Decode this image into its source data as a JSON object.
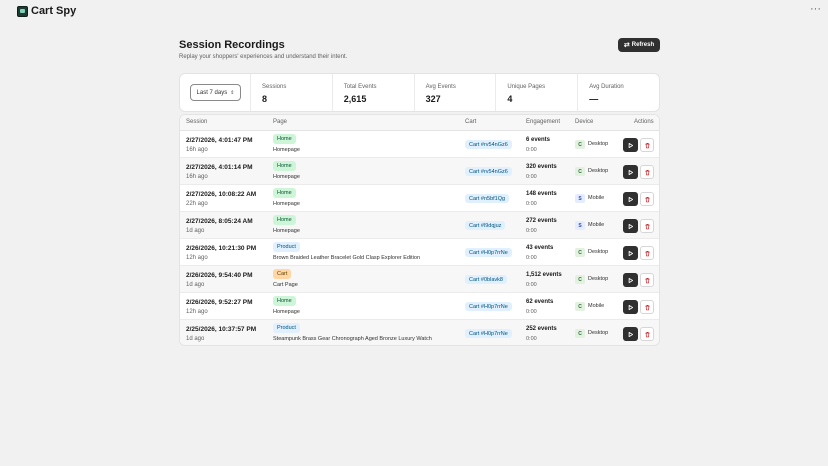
{
  "app": {
    "title": "Cart Spy",
    "more_label": "···"
  },
  "header": {
    "title": "Session Recordings",
    "subtitle": "Replay your shoppers' experiences and understand their intent.",
    "refresh_label": "Refresh"
  },
  "filter": {
    "range_label": "Last 7 days"
  },
  "stats": [
    {
      "label": "Sessions",
      "value": "8"
    },
    {
      "label": "Total Events",
      "value": "2,615"
    },
    {
      "label": "Avg Events",
      "value": "327"
    },
    {
      "label": "Unique Pages",
      "value": "4"
    },
    {
      "label": "Avg Duration",
      "value": "—"
    }
  ],
  "table": {
    "columns": {
      "session": "Session",
      "page": "Page",
      "cart": "Cart",
      "engagement": "Engagement",
      "device": "Device",
      "actions": "Actions"
    },
    "rows": [
      {
        "date": "2/27/2026, 4:01:47 PM",
        "ago": "16h ago",
        "page_type": "Home",
        "page_kind": "home",
        "page_name": "Homepage",
        "cart": "Cart #rv54nGz6",
        "events": "6 events",
        "duration": "0:00",
        "device": "Desktop",
        "device_initial": "C",
        "device_kind": "desktop"
      },
      {
        "date": "2/27/2026, 4:01:14 PM",
        "ago": "16h ago",
        "page_type": "Home",
        "page_kind": "home",
        "page_name": "Homepage",
        "cart": "Cart #rv54nGz6",
        "events": "320 events",
        "duration": "0:00",
        "device": "Desktop",
        "device_initial": "C",
        "device_kind": "desktop"
      },
      {
        "date": "2/27/2026, 10:08:22 AM",
        "ago": "22h ago",
        "page_type": "Home",
        "page_kind": "home",
        "page_name": "Homepage",
        "cart": "Cart #n5bf1Qg",
        "events": "148 events",
        "duration": "0:00",
        "device": "Mobile",
        "device_initial": "S",
        "device_kind": "mobile"
      },
      {
        "date": "2/27/2026, 8:05:24 AM",
        "ago": "1d ago",
        "page_type": "Home",
        "page_kind": "home",
        "page_name": "Homepage",
        "cart": "Cart #l9dqjuz",
        "events": "272 events",
        "duration": "0:00",
        "device": "Mobile",
        "device_initial": "S",
        "device_kind": "mobile"
      },
      {
        "date": "2/26/2026, 10:21:30 PM",
        "ago": "12h ago",
        "page_type": "Product",
        "page_kind": "product",
        "page_name": "Brown Braided Leather Bracelet Gold Clasp Explorer Edition",
        "cart": "Cart #H0p7rrNe",
        "events": "43 events",
        "duration": "0:00",
        "device": "Desktop",
        "device_initial": "C",
        "device_kind": "desktop"
      },
      {
        "date": "2/26/2026, 9:54:40 PM",
        "ago": "1d ago",
        "page_type": "Cart",
        "page_kind": "cart",
        "page_name": "Cart Page",
        "cart": "Cart #0blavk8",
        "events": "1,512 events",
        "duration": "0:00",
        "device": "Desktop",
        "device_initial": "C",
        "device_kind": "desktop"
      },
      {
        "date": "2/26/2026, 9:52:27 PM",
        "ago": "12h ago",
        "page_type": "Home",
        "page_kind": "home",
        "page_name": "Homepage",
        "cart": "Cart #H0p7rrNe",
        "events": "62 events",
        "duration": "0:00",
        "device": "Mobile",
        "device_initial": "C",
        "device_kind": "desktop"
      },
      {
        "date": "2/25/2026, 10:37:57 PM",
        "ago": "1d ago",
        "page_type": "Product",
        "page_kind": "product",
        "page_name": "Steampunk Brass Gear Chronograph Aged Bronze Luxury Watch",
        "cart": "Cart #H0p7rrNe",
        "events": "252 events",
        "duration": "0:00",
        "device": "Desktop",
        "device_initial": "C",
        "device_kind": "desktop"
      }
    ]
  },
  "colors": {
    "primary_button": "#303030",
    "home_badge": "#cdf6d9",
    "product_badge": "#e0f0ff",
    "cart_badge": "#ffd6a4",
    "delete_icon": "#c5282f"
  }
}
